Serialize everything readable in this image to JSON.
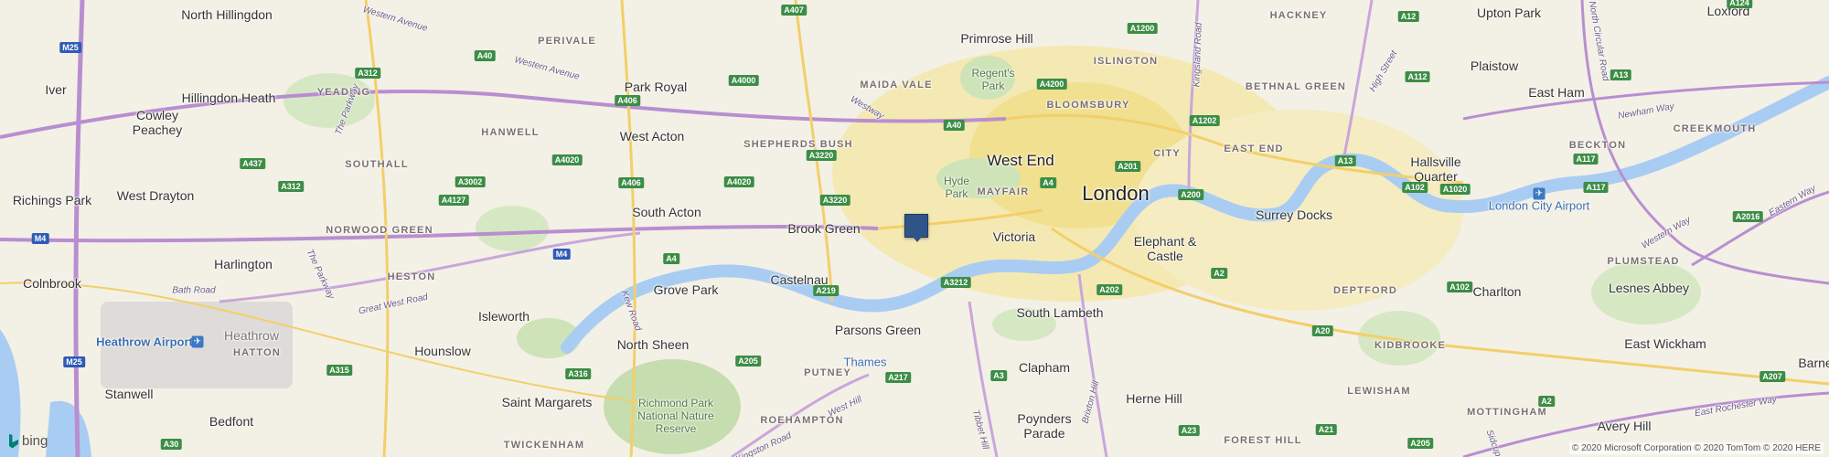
{
  "colors": {
    "land": "#f3f0e6",
    "park": "#cfe3b8",
    "urban": "#f2e6a6",
    "river": "#a9cdf2",
    "motorway": "#b98ed0",
    "a_road": "#f3cf6a",
    "marker": "#2f5487"
  },
  "marker": {
    "icon": "location-marker-icon"
  },
  "places": {
    "north_hillingdon": "North Hillingdon",
    "primrose_hill": "Primrose Hill",
    "hackney": "HACKNEY",
    "upton_park": "Upton Park",
    "loxford": "Loxford",
    "perivale": "PERIVALE",
    "islington": "ISLINGTON",
    "iver": "Iver",
    "park_royal": "Park Royal",
    "maida_vale": "MAIDA VALE",
    "regents_park": "Regent's Park",
    "bethnal_green": "BETHNAL GREEN",
    "plaistow": "Plaistow",
    "east_ham": "East Ham",
    "yeading": "YEADING",
    "cowley_peachey": "Cowley Peachey",
    "hillingdon_heath": "Hillingdon Heath",
    "bloomsbury": "BLOOMSBURY",
    "creekmouth": "CREEKMOUTH",
    "hanwell": "HANWELL",
    "west_acton": "West Acton",
    "shepherds_bush": "SHEPHERDS BUSH",
    "east_end": "EAST END",
    "city": "CITY",
    "beckton": "BECKTON",
    "hallsville_quarter": "Hallsville Quarter",
    "southall": "SOUTHALL",
    "west_end": "West End",
    "mayfair": "MAYFAIR",
    "hyde_park": "Hyde Park",
    "london": "London",
    "richings_park": "Richings Park",
    "west_drayton": "West Drayton",
    "south_acton": "South Acton",
    "surrey_docks": "Surrey Docks",
    "london_city_airport": "London City Airport",
    "brook_green": "Brook Green",
    "norwood_green": "NORWOOD GREEN",
    "victoria": "Victoria",
    "elephant_castle": "Elephant & Castle",
    "harlington": "Harlington",
    "plumstead": "PLUMSTEAD",
    "colnbrook": "Colnbrook",
    "heston": "HESTON",
    "grove_park": "Grove Park",
    "castelnau": "Castelnau",
    "deptford": "DEPTFORD",
    "charlton": "Charlton",
    "lesnes_abbey": "Lesnes Abbey",
    "isleworth": "Isleworth",
    "south_lambeth": "South Lambeth",
    "parsons_green": "Parsons Green",
    "heathrow_airport": "Heathrow Airport",
    "heathrow": "Heathrow",
    "hatton": "HATTON",
    "north_sheen": "North Sheen",
    "hounslow": "Hounslow",
    "kidbrooke": "KIDBROOKE",
    "east_wickham": "East Wickham",
    "thames": "Thames",
    "putney": "PUTNEY",
    "clapham": "Clapham",
    "barne": "Barne",
    "stanwell": "Stanwell",
    "st_margarets": "Saint Margarets",
    "richmond_park": "Richmond Park National Nature Reserve",
    "herne_hill": "Herne Hill",
    "lewisham": "LEWISHAM",
    "mottingham": "MOTTINGHAM",
    "avery_hill": "Avery Hill",
    "bedfont": "Bedfont",
    "roehampton": "ROEHAMPTON",
    "poynders_parade": "Poynders Parade",
    "twickenham": "TWICKENHAM",
    "forest_hill": "FOREST HILL"
  },
  "roads": {
    "western_avenue": "Western Avenue",
    "western_avenue_2": "Western Avenue",
    "the_parkway": "The Parkway",
    "the_parkway_2": "The Parkway",
    "westway": "Westway",
    "kingsland_road": "Kingsland Road",
    "high_street": "High Street",
    "north_circular_road": "North Circular Road",
    "newham_way": "Newham Way",
    "bath_road": "Bath Road",
    "great_west_road": "Great West Road",
    "kew_road": "Kew Road",
    "western_way": "Western Way",
    "eastern_way": "Eastern Way",
    "brixton_hill": "Brixton Hill",
    "tibbet_hill": "Tibbet Hill",
    "west_hill": "West Hill",
    "kingston_road": "Kingston Road",
    "east_rochester_way": "East Rochester Way",
    "sidcup": "Sidcup"
  },
  "shields": {
    "m25": "M25",
    "m25b": "M25",
    "m4": "M4",
    "m4b": "M4",
    "a407": "A407",
    "a1200": "A1200",
    "a12": "A12",
    "a124": "A124",
    "a40": "A40",
    "a40b": "A40",
    "a312": "A312",
    "a4000": "A4000",
    "a4200": "A4200",
    "a112": "A112",
    "a13": "A13",
    "a406": "A406",
    "a1202": "A1202",
    "a437": "A437",
    "a4020": "A4020",
    "a3220": "A3220",
    "a3220b": "A3220",
    "a201": "A201",
    "a4": "A4",
    "a4b": "A4",
    "a4c": "A4",
    "a117": "A117",
    "a117b": "A117",
    "a102": "A102",
    "a1020": "A1020",
    "a312b": "A312",
    "a3002": "A3002",
    "a406b": "A406",
    "a4020b": "A4020",
    "a200": "A200",
    "a2016": "A2016",
    "a4127": "A4127",
    "a219": "A219",
    "a3212": "A3212",
    "a202": "A202",
    "a2": "A2",
    "a2b": "A2",
    "a102b": "A102",
    "a20": "A20",
    "a205": "A205",
    "a205b": "A205",
    "a315": "A315",
    "a316": "A316",
    "a217": "A217",
    "a3": "A3",
    "a207": "A207",
    "a23": "A23",
    "a21": "A21",
    "a30": "A30",
    "a2c": "A2"
  },
  "brand": {
    "name": "bing"
  },
  "copyright": "© 2020 Microsoft Corporation © 2020 TomTom © 2020 HERE"
}
